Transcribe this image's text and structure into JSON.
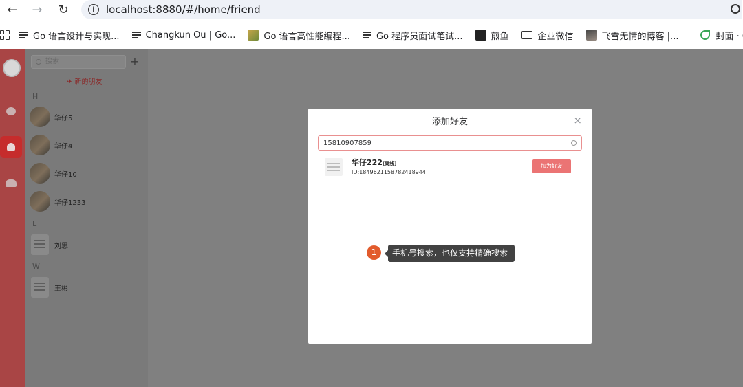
{
  "browser": {
    "url_host": "localhost",
    "url_rest": ":8880/#/home/friend",
    "bookmarks": [
      "Go 语言设计与实现...",
      "Changkun Ou | Go...",
      "Go 语言高性能编程...",
      "Go 程序员面试笔试...",
      "煎鱼",
      "企业微信",
      "飞雪无情的博客 |...",
      "封面 · Gol"
    ]
  },
  "sidebar": {
    "search_placeholder": "搜索",
    "add_label": "+",
    "new_friend_label": "✈ 新的朋友",
    "groups": [
      {
        "letter": "H",
        "contacts": [
          "华仔5",
          "华仔4",
          "华仔10",
          "华仔1233"
        ]
      },
      {
        "letter": "L",
        "contacts": [
          "刘思"
        ]
      },
      {
        "letter": "W",
        "contacts": [
          "王彬"
        ]
      }
    ]
  },
  "modal": {
    "title": "添加好友",
    "close": "×",
    "search_value": "15810907859",
    "result": {
      "name": "华仔222",
      "status": "[离线]",
      "id": "ID:1849621158782418944"
    },
    "add_button": "加为好友"
  },
  "annotation": {
    "badge": "1",
    "text": "手机号搜索，也仅支持精确搜索"
  },
  "colors": {
    "accent": "#eb7474",
    "rail": "#a94545",
    "badge": "#e25b2c"
  }
}
